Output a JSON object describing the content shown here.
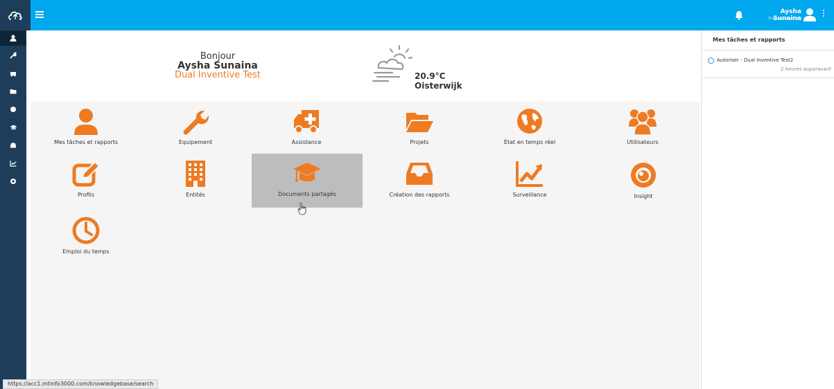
{
  "header": {
    "user_name": "Aysha Sunaina",
    "user_org": "Dual Inventive Test",
    "brand_color": "#00a8ee",
    "sidebar_color": "#1e3d5a",
    "accent_color": "#ee7b22"
  },
  "sidebar": {
    "items": [
      "user-icon",
      "wrench-icon",
      "ambulance-icon",
      "folder-icon",
      "globe-icon",
      "graduation-cap-icon",
      "inbox-icon",
      "chart-line-icon",
      "eye-icon"
    ]
  },
  "welcome": {
    "greeting": "Bonjour",
    "name": "Aysha Sunaina",
    "organization": "Dual Inventive Test",
    "temperature": "20.9°C",
    "city": "Oisterwijk"
  },
  "tiles": [
    {
      "label": "Mes tâches et rapports",
      "icon": "user-icon"
    },
    {
      "label": "Equipement",
      "icon": "wrench-icon"
    },
    {
      "label": "Assistance",
      "icon": "ambulance-icon"
    },
    {
      "label": "Projets",
      "icon": "folder-icon"
    },
    {
      "label": "État en temps réel",
      "icon": "globe-icon"
    },
    {
      "label": "Utilisateurs",
      "icon": "users-icon"
    },
    {
      "label": "Profils",
      "icon": "edit-icon"
    },
    {
      "label": "Entités",
      "icon": "building-icon"
    },
    {
      "label": "Documents partagés",
      "icon": "graduation-cap-icon"
    },
    {
      "label": "Création des rapports",
      "icon": "inbox-icon"
    },
    {
      "label": "Surveillance",
      "icon": "chart-line-icon"
    },
    {
      "label": "Insight",
      "icon": "eye-icon"
    },
    {
      "label": "Emploi du temps",
      "icon": "clock-icon"
    }
  ],
  "tasks_panel": {
    "title": "Mes tâches et rapports",
    "items": [
      {
        "label": "Autoriser - Dual Inventive Test2",
        "time": "2 heures auparavant"
      }
    ]
  },
  "status_url": "https://acc1.mtinfo3000.com/knowledgebase/search"
}
